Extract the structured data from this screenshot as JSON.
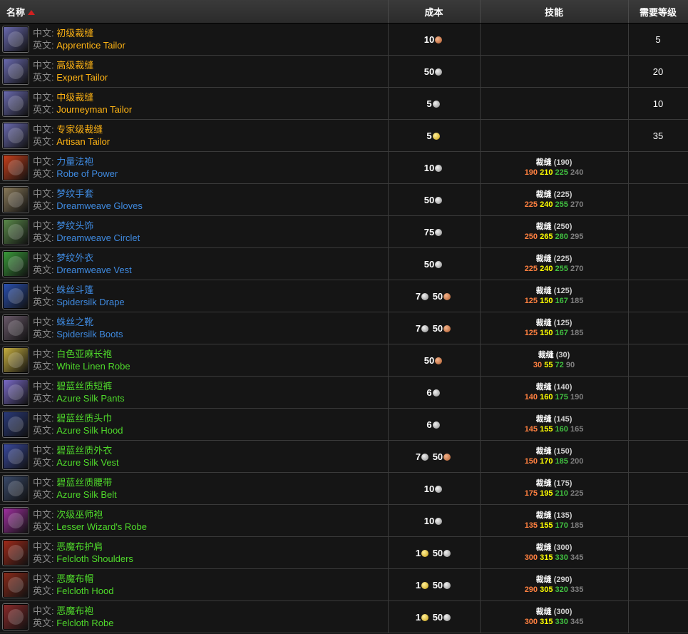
{
  "header": {
    "name_label": "名称",
    "cost_label": "成本",
    "skill_label": "技能",
    "level_label": "需要等级"
  },
  "labels": {
    "cn": "中文: ",
    "en": "英文: "
  },
  "colors": {
    "orange": "#ffb414",
    "blue": "#3f8ae0",
    "green": "#4fd92b"
  },
  "rows": [
    {
      "icon": "thread-spool-icon",
      "icon_color": "#6a6ab0",
      "quality": "orange",
      "cn": "初级裁缝",
      "en": "Apprentice Tailor",
      "cost": [
        {
          "amount": "10",
          "coin": "copper"
        }
      ],
      "skill": null,
      "level": "5"
    },
    {
      "icon": "thread-spool-icon",
      "icon_color": "#6a6ab0",
      "quality": "orange",
      "cn": "高级裁缝",
      "en": "Expert Tailor",
      "cost": [
        {
          "amount": "50",
          "coin": "silver"
        }
      ],
      "skill": null,
      "level": "20"
    },
    {
      "icon": "thread-spool-icon",
      "icon_color": "#6a6ab0",
      "quality": "orange",
      "cn": "中级裁缝",
      "en": "Journeyman Tailor",
      "cost": [
        {
          "amount": "5",
          "coin": "silver"
        }
      ],
      "skill": null,
      "level": "10"
    },
    {
      "icon": "thread-spool-icon",
      "icon_color": "#6a6ab0",
      "quality": "orange",
      "cn": "专家级裁缝",
      "en": "Artisan Tailor",
      "cost": [
        {
          "amount": "5",
          "coin": "gold"
        }
      ],
      "skill": null,
      "level": "35"
    },
    {
      "icon": "robe-icon",
      "icon_color": "#c8401c",
      "quality": "blue",
      "cn": "力量法袍",
      "en": "Robe of Power",
      "cost": [
        {
          "amount": "10",
          "coin": "silver"
        }
      ],
      "skill": {
        "name": "裁缝",
        "req": "(190)",
        "levels": [
          "190",
          "210",
          "225",
          "240"
        ]
      },
      "level": ""
    },
    {
      "icon": "gloves-icon",
      "icon_color": "#8a7a5a",
      "quality": "blue",
      "cn": "梦纹手套",
      "en": "Dreamweave Gloves",
      "cost": [
        {
          "amount": "50",
          "coin": "silver"
        }
      ],
      "skill": {
        "name": "裁缝",
        "req": "(225)",
        "levels": [
          "225",
          "240",
          "255",
          "270"
        ]
      },
      "level": ""
    },
    {
      "icon": "circlet-icon",
      "icon_color": "#5a8a4a",
      "quality": "blue",
      "cn": "梦纹头饰",
      "en": "Dreamweave Circlet",
      "cost": [
        {
          "amount": "75",
          "coin": "silver"
        }
      ],
      "skill": {
        "name": "裁缝",
        "req": "(250)",
        "levels": [
          "250",
          "265",
          "280",
          "295"
        ]
      },
      "level": ""
    },
    {
      "icon": "vest-icon",
      "icon_color": "#3a9a3a",
      "quality": "blue",
      "cn": "梦纹外衣",
      "en": "Dreamweave Vest",
      "cost": [
        {
          "amount": "50",
          "coin": "silver"
        }
      ],
      "skill": {
        "name": "裁缝",
        "req": "(225)",
        "levels": [
          "225",
          "240",
          "255",
          "270"
        ]
      },
      "level": ""
    },
    {
      "icon": "cloak-icon",
      "icon_color": "#2a50b0",
      "quality": "blue",
      "cn": "蛛丝斗篷",
      "en": "Spidersilk Drape",
      "cost": [
        {
          "amount": "7",
          "coin": "silver"
        },
        {
          "amount": "50",
          "coin": "copper"
        }
      ],
      "skill": {
        "name": "裁缝",
        "req": "(125)",
        "levels": [
          "125",
          "150",
          "167",
          "185"
        ]
      },
      "level": ""
    },
    {
      "icon": "boots-icon",
      "icon_color": "#6a5a6a",
      "quality": "blue",
      "cn": "蛛丝之靴",
      "en": "Spidersilk Boots",
      "cost": [
        {
          "amount": "7",
          "coin": "silver"
        },
        {
          "amount": "50",
          "coin": "copper"
        }
      ],
      "skill": {
        "name": "裁缝",
        "req": "(125)",
        "levels": [
          "125",
          "150",
          "167",
          "185"
        ]
      },
      "level": ""
    },
    {
      "icon": "robe-icon",
      "icon_color": "#c8b040",
      "quality": "green",
      "cn": "白色亚麻长袍",
      "en": "White Linen Robe",
      "cost": [
        {
          "amount": "50",
          "coin": "copper"
        }
      ],
      "skill": {
        "name": "裁缝",
        "req": "(30)",
        "levels": [
          "30",
          "55",
          "72",
          "90"
        ]
      },
      "level": ""
    },
    {
      "icon": "pants-icon",
      "icon_color": "#7a6ac8",
      "quality": "green",
      "cn": "碧蓝丝质短裤",
      "en": "Azure Silk Pants",
      "cost": [
        {
          "amount": "6",
          "coin": "silver"
        }
      ],
      "skill": {
        "name": "裁缝",
        "req": "(140)",
        "levels": [
          "140",
          "160",
          "175",
          "190"
        ]
      },
      "level": ""
    },
    {
      "icon": "hood-icon",
      "icon_color": "#2a3a7a",
      "quality": "green",
      "cn": "碧蓝丝质头巾",
      "en": "Azure Silk Hood",
      "cost": [
        {
          "amount": "6",
          "coin": "silver"
        }
      ],
      "skill": {
        "name": "裁缝",
        "req": "(145)",
        "levels": [
          "145",
          "155",
          "160",
          "165"
        ]
      },
      "level": ""
    },
    {
      "icon": "vest-icon",
      "icon_color": "#3a4aa0",
      "quality": "green",
      "cn": "碧蓝丝质外衣",
      "en": "Azure Silk Vest",
      "cost": [
        {
          "amount": "7",
          "coin": "silver"
        },
        {
          "amount": "50",
          "coin": "copper"
        }
      ],
      "skill": {
        "name": "裁缝",
        "req": "(150)",
        "levels": [
          "150",
          "170",
          "185",
          "200"
        ]
      },
      "level": ""
    },
    {
      "icon": "belt-icon",
      "icon_color": "#3a4a6a",
      "quality": "green",
      "cn": "碧蓝丝质腰带",
      "en": "Azure Silk Belt",
      "cost": [
        {
          "amount": "10",
          "coin": "silver"
        }
      ],
      "skill": {
        "name": "裁缝",
        "req": "(175)",
        "levels": [
          "175",
          "195",
          "210",
          "225"
        ]
      },
      "level": ""
    },
    {
      "icon": "robe-icon",
      "icon_color": "#a030a0",
      "quality": "green",
      "cn": "次级巫师袍",
      "en": "Lesser Wizard's Robe",
      "cost": [
        {
          "amount": "10",
          "coin": "silver"
        }
      ],
      "skill": {
        "name": "裁缝",
        "req": "(135)",
        "levels": [
          "135",
          "155",
          "170",
          "185"
        ]
      },
      "level": ""
    },
    {
      "icon": "shoulders-icon",
      "icon_color": "#a02a1a",
      "quality": "green",
      "cn": "恶魔布护肩",
      "en": "Felcloth Shoulders",
      "cost": [
        {
          "amount": "1",
          "coin": "gold"
        },
        {
          "amount": "50",
          "coin": "silver"
        }
      ],
      "skill": {
        "name": "裁缝",
        "req": "(300)",
        "levels": [
          "300",
          "315",
          "330",
          "345"
        ]
      },
      "level": ""
    },
    {
      "icon": "hood-icon",
      "icon_color": "#8a2a1a",
      "quality": "green",
      "cn": "恶魔布帽",
      "en": "Felcloth Hood",
      "cost": [
        {
          "amount": "1",
          "coin": "gold"
        },
        {
          "amount": "50",
          "coin": "silver"
        }
      ],
      "skill": {
        "name": "裁缝",
        "req": "(290)",
        "levels": [
          "290",
          "305",
          "320",
          "335"
        ]
      },
      "level": ""
    },
    {
      "icon": "robe-icon",
      "icon_color": "#8a2a2a",
      "quality": "green",
      "cn": "恶魔布袍",
      "en": "Felcloth Robe",
      "cost": [
        {
          "amount": "1",
          "coin": "gold"
        },
        {
          "amount": "50",
          "coin": "silver"
        }
      ],
      "skill": {
        "name": "裁缝",
        "req": "(300)",
        "levels": [
          "300",
          "315",
          "330",
          "345"
        ]
      },
      "level": ""
    }
  ]
}
